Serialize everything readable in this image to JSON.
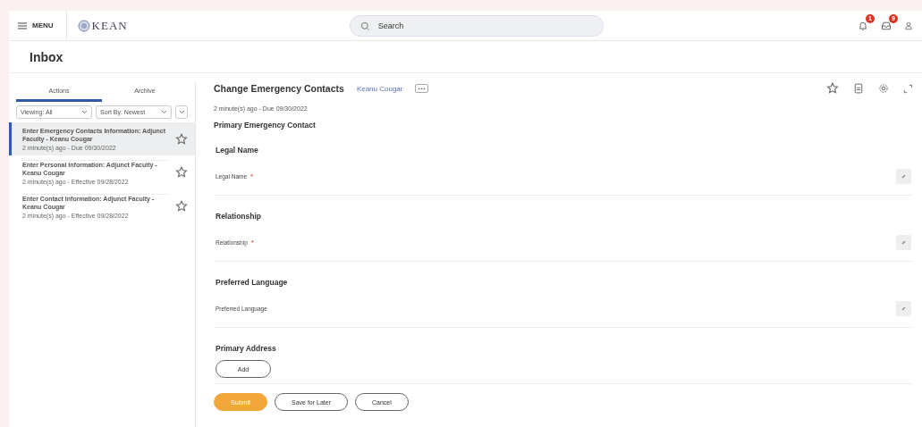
{
  "topbar": {
    "menu_label": "MENU",
    "logo_text": "KEAN",
    "search": {
      "placeholder": "Search"
    },
    "notifications_badge": "1",
    "inbox_badge": "9"
  },
  "page_title": "Inbox",
  "inbox": {
    "tabs": [
      {
        "label": "Actions",
        "selected": true
      },
      {
        "label": "Archive",
        "selected": false
      }
    ],
    "filters": [
      "Viewing: All",
      "Sort By: Newest"
    ],
    "items": [
      {
        "title": "Enter Emergency Contacts Information: Adjunct Faculty - Keanu Cougar",
        "meta": "2 minute(s) ago - Due 09/30/2022",
        "selected": true
      },
      {
        "title": "Enter Personal Information: Adjunct Faculty - Keanu Cougar",
        "meta": "2 minute(s) ago - Effective 09/28/2022",
        "selected": false
      },
      {
        "title": "Enter Contact Information: Adjunct Faculty - Keanu Cougar",
        "meta": "2 minute(s) ago - Effective 09/28/2022",
        "selected": false
      }
    ]
  },
  "task": {
    "title": "Change Emergency Contacts",
    "person": "Keanu Cougar",
    "meta": "2 minute(s) ago - Due 09/30/2022",
    "section_title": "Primary Emergency Contact",
    "sections": [
      {
        "heading": "Legal Name",
        "kind": "field",
        "label": "Legal Name",
        "required": true
      },
      {
        "heading": "Relationship",
        "kind": "field",
        "label": "Relationship",
        "required": true
      },
      {
        "heading": "Preferred Language",
        "kind": "field",
        "label": "Preferred Language",
        "required": false
      },
      {
        "heading": "Primary Address",
        "kind": "add",
        "button": "Add"
      }
    ],
    "required_mark": "*",
    "actions": [
      {
        "label": "Submit",
        "kind": "primary"
      },
      {
        "label": "Save for Later",
        "kind": "secondary"
      },
      {
        "label": "Cancel",
        "kind": "secondary"
      }
    ]
  }
}
